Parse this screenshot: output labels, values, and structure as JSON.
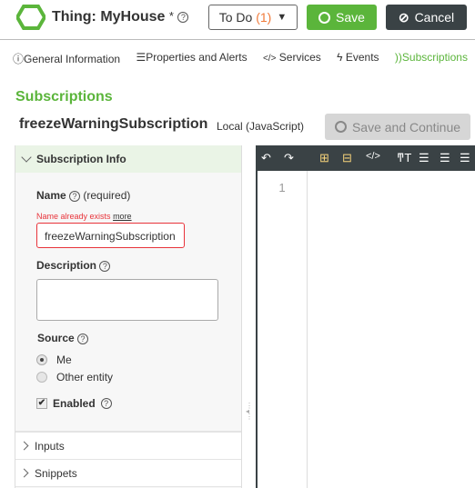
{
  "header": {
    "title": "Thing: MyHouse",
    "modified_marker": "*",
    "todo_label": "To Do",
    "todo_count": "(1)",
    "save_label": "Save",
    "cancel_label": "Cancel"
  },
  "tabs": [
    {
      "label": "General Information",
      "icon": "info-icon"
    },
    {
      "label": "Properties and Alerts",
      "icon": "list-icon"
    },
    {
      "label": "Services",
      "icon": "code-icon"
    },
    {
      "label": "Events",
      "icon": "bolt-icon"
    },
    {
      "label": "Subscriptions",
      "icon": "rss-icon",
      "active": true
    }
  ],
  "section_title": "Subscriptions",
  "subscription": {
    "name": "freezeWarningSubscription",
    "type": "Local (JavaScript)",
    "save_continue_label": "Save and Continue"
  },
  "panel": {
    "header": "Subscription Info",
    "name_label": "Name",
    "required": "(required)",
    "error": "Name already exists",
    "error_link": "more",
    "name_value": "freezeWarningSubscription",
    "description_label": "Description",
    "description_value": "",
    "source_label": "Source",
    "source_options": [
      "Me",
      "Other entity"
    ],
    "source_selected": "Me",
    "enabled_label": "Enabled",
    "enabled": true,
    "inputs_label": "Inputs",
    "snippets_label": "Snippets"
  },
  "editor": {
    "line_numbers": [
      "1"
    ]
  },
  "colors": {
    "accent": "#5bb53b",
    "error": "#e8333a",
    "dark": "#3a4245"
  }
}
